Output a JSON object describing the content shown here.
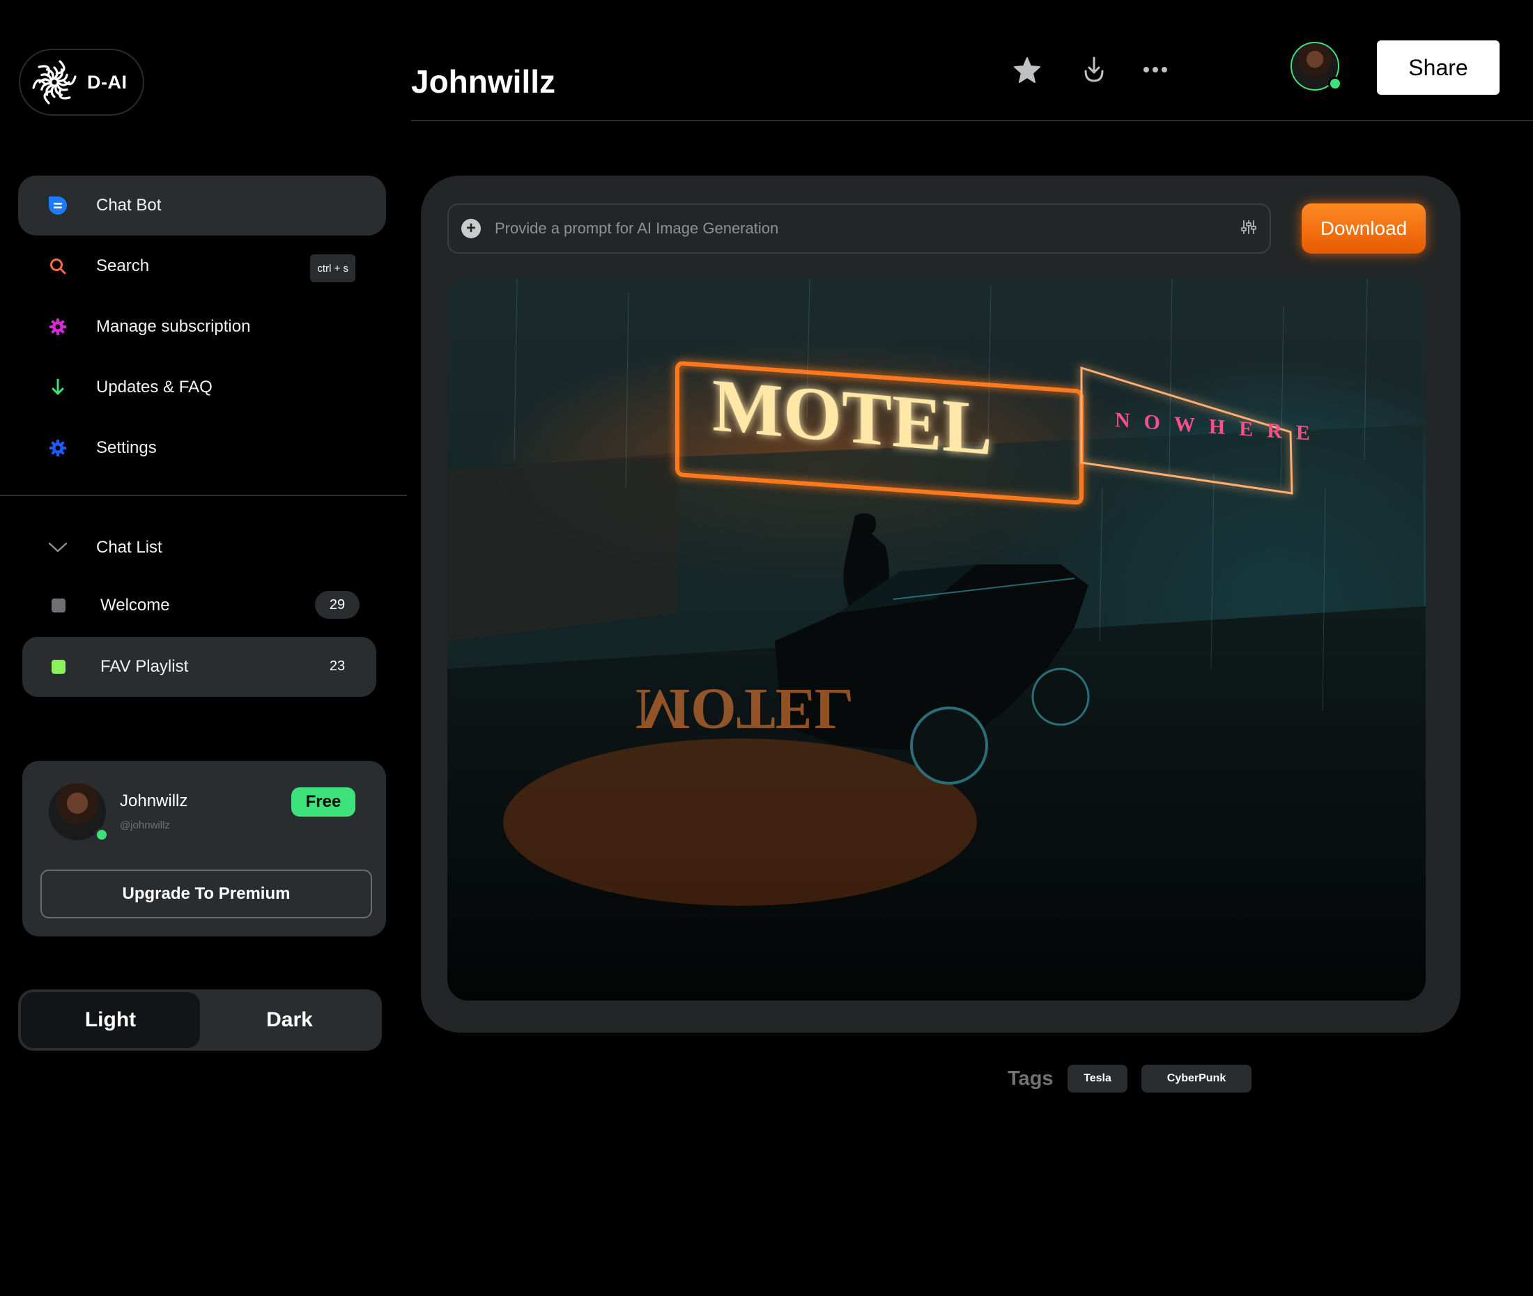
{
  "app": {
    "name": "D-AI"
  },
  "nav": {
    "items": [
      {
        "label": "Chat Bot",
        "icon": "chat-icon",
        "color": "#1e7bff",
        "active": true
      },
      {
        "label": "Search",
        "icon": "search-icon",
        "color": "#ff6b3d",
        "shortcut": "ctrl + s"
      },
      {
        "label": "Manage subscription",
        "icon": "gear-icon",
        "color": "#d42bd4"
      },
      {
        "label": "Updates & FAQ",
        "icon": "arrow-down-icon",
        "color": "#3ee27a"
      },
      {
        "label": "Settings",
        "icon": "gear-icon",
        "color": "#1e5bff"
      }
    ]
  },
  "chat_list": {
    "header": "Chat List",
    "items": [
      {
        "label": "Welcome",
        "count": "29",
        "color": "#6e7174"
      },
      {
        "label": "FAV Playlist",
        "count": "23",
        "color": "#8af25a",
        "active": true
      }
    ]
  },
  "profile": {
    "name": "Johnwillz",
    "handle": "@johnwillz",
    "plan": "Free",
    "upgrade_label": "Upgrade To Premium"
  },
  "theme": {
    "light_label": "Light",
    "dark_label": "Dark",
    "selected": "Light"
  },
  "header": {
    "title": "Johnwillz",
    "share_label": "Share",
    "icons": [
      "star-icon",
      "download-icon",
      "more-icon"
    ]
  },
  "generator": {
    "prompt_placeholder": "Provide a prompt for AI Image Generation",
    "download_label": "Download",
    "image": {
      "sign_main": "MOTEL",
      "sign_sub": "NOWHERE"
    }
  },
  "tags": {
    "label": "Tags",
    "items": [
      "Tesla",
      "CyberPunk"
    ]
  },
  "colors": {
    "accent_green": "#3ee27a",
    "accent_orange": "#ff7a1a",
    "panel": "#222627",
    "surface": "#2a2d2f"
  }
}
